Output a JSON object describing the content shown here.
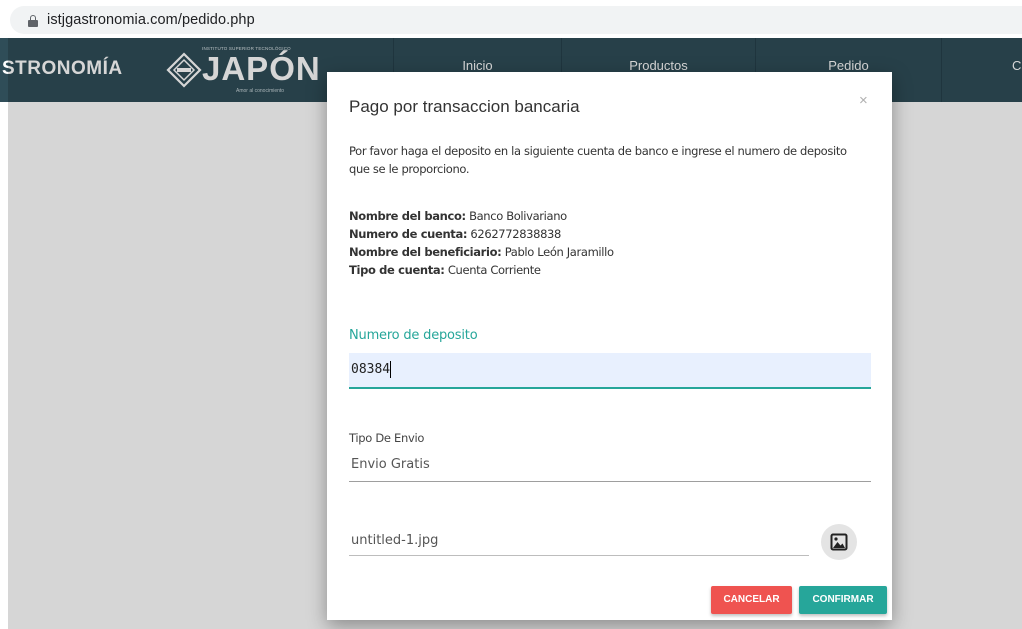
{
  "browser": {
    "url": "istjgastronomia.com/pedido.php"
  },
  "header": {
    "brand_text": "STRONOMÍA",
    "logo": {
      "superscript": "INSTITUTO SUPERIOR TECNOLÓGICO",
      "main": "JAPÓN",
      "tagline": "Amor al conocimiento"
    },
    "nav": [
      "Inicio",
      "Productos",
      "Pedido",
      "Ca"
    ]
  },
  "modal": {
    "title": "Pago por transaccion bancaria",
    "close": "×",
    "intro": "Por favor haga el deposito en la siguiente cuenta de banco e ingrese el numero de deposito que se le proporciono.",
    "bank": [
      {
        "label": "Nombre del banco:",
        "value": "Banco Bolivariano"
      },
      {
        "label": "Numero de cuenta:",
        "value": "6262772838838"
      },
      {
        "label": "Nombre del beneficiario:",
        "value": "Pablo León Jaramillo"
      },
      {
        "label": "Tipo de cuenta:",
        "value": "Cuenta Corriente"
      }
    ],
    "deposit": {
      "label": "Numero de deposito",
      "value": "08384"
    },
    "shipping": {
      "label": "Tipo De Envio",
      "value": "Envio Gratis"
    },
    "file": {
      "value": "untitled-1.jpg",
      "icon": "image-upload-icon"
    },
    "buttons": {
      "cancel": "CANCELAR",
      "confirm": "CONFIRMAR"
    },
    "colors": {
      "accent": "#26a69a",
      "danger": "#ef5350",
      "header": "#2f4d58"
    }
  }
}
